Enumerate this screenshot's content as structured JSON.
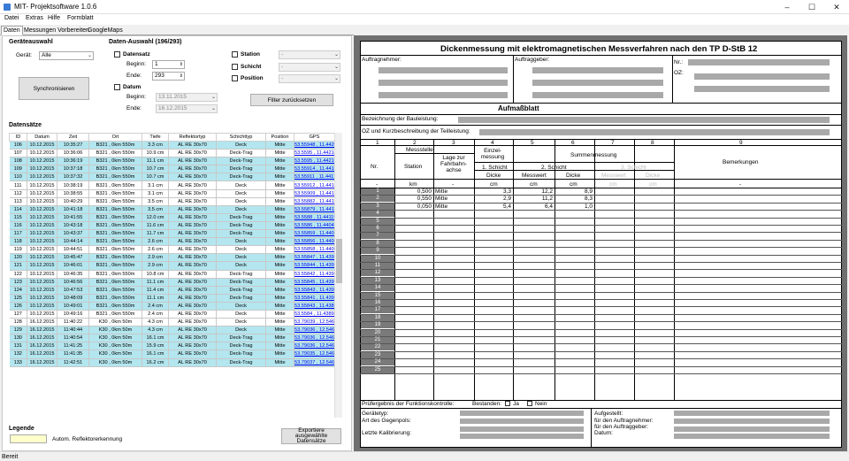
{
  "window": {
    "title": "MIT- Projektsoftware 1.0.6",
    "min": "–",
    "max": "☐",
    "close": "✕"
  },
  "menu": [
    "Datei",
    "Extras",
    "Hilfe",
    "Formblatt"
  ],
  "tabs": [
    "Daten",
    "Messungen Vorbereiten",
    "GoogleMaps"
  ],
  "geraet": {
    "group": "Geräteauswahl",
    "label": "Gerät:",
    "value": "Alle",
    "sync": "Synchronisieren"
  },
  "filter": {
    "group": "Daten-Auswahl (196/293)",
    "datensatz": "Datensatz",
    "beginn": "Beginn:",
    "ende": "Ende:",
    "beginn_val": "1",
    "ende_val": "293",
    "datum": "Datum",
    "datum_beginn": "13.11.2015",
    "datum_ende": "16.12.2015",
    "station": "Station",
    "schicht": "Schicht",
    "position": "Position",
    "dash": "-",
    "reset": "Filter zurücksetzen"
  },
  "datensaetze": {
    "title": "Datensätze",
    "headers": [
      "ID",
      "Datum",
      "Zeit",
      "Ort",
      "Tiefe",
      "Reflektortyp",
      "Schichttyp",
      "Position",
      "GPS"
    ],
    "rows": [
      [
        "106",
        "10.12.2015",
        "10:35:27",
        "B321 , 0km 550m",
        "3.3 cm",
        "AL RE 30x70",
        "Deck",
        "Mitte",
        "53.55948 , 11.44208",
        "cy"
      ],
      [
        "107",
        "10.12.2015",
        "10:36:06",
        "B321 , 0km 550m",
        "10.9 cm",
        "AL RE 30x70",
        "Deck-Trag",
        "Mitte",
        "53.5595 , 11.44214",
        "wh"
      ],
      [
        "108",
        "10.12.2015",
        "10:36:19",
        "B321 , 0km 550m",
        "11.1 cm",
        "AL RE 30x70",
        "Deck-Trag",
        "Mitte",
        "53.5595 , 11.44213",
        "cy"
      ],
      [
        "109",
        "10.12.2015",
        "10:37:18",
        "B321 , 0km 550m",
        "10.7 cm",
        "AL RE 30x70",
        "Deck-Trag",
        "Mitte",
        "53.55914 , 11.44169",
        "cy"
      ],
      [
        "110",
        "10.12.2015",
        "10:37:32",
        "B321 , 0km 550m",
        "10.7 cm",
        "AL RE 30x70",
        "Deck-Trag",
        "Mitte",
        "53.55911 , 11.44172",
        "cy"
      ],
      [
        "111",
        "10.12.2015",
        "10:38:19",
        "B321 , 0km 550m",
        "3.1 cm",
        "AL RE 30x70",
        "Deck",
        "Mitte",
        "53.55912 , 11.44166",
        "wh"
      ],
      [
        "112",
        "10.12.2015",
        "10:38:55",
        "B321 , 0km 550m",
        "3.1 cm",
        "AL RE 30x70",
        "Deck",
        "Mitte",
        "53.55909 , 11.44171",
        "wh"
      ],
      [
        "113",
        "10.12.2015",
        "10:40:29",
        "B321 , 0km 550m",
        "3.5 cm",
        "AL RE 30x70",
        "Deck",
        "Mitte",
        "53.55882 , 11.44112",
        "wh"
      ],
      [
        "114",
        "10.12.2015",
        "10:41:18",
        "B321 , 0km 550m",
        "3.5 cm",
        "AL RE 30x70",
        "Deck",
        "Mitte",
        "53.55879 , 11.44116",
        "cy"
      ],
      [
        "115",
        "10.12.2015",
        "10:41:55",
        "B321 , 0km 550m",
        "12.0 cm",
        "AL RE 30x70",
        "Deck-Trag",
        "Mitte",
        "53.5588 , 11.44119",
        "cy"
      ],
      [
        "116",
        "10.12.2015",
        "10:43:18",
        "B321 , 0km 550m",
        "11.6 cm",
        "AL RE 30x70",
        "Deck-Trag",
        "Mitte",
        "53.5586 , 11.44049",
        "cy"
      ],
      [
        "117",
        "10.12.2015",
        "10:43:37",
        "B321 , 0km 550m",
        "11.7 cm",
        "AL RE 30x70",
        "Deck-Trag",
        "Mitte",
        "53.55859 , 11.44051",
        "cy"
      ],
      [
        "118",
        "10.12.2015",
        "10:44:14",
        "B321 , 0km 550m",
        "2.6 cm",
        "AL RE 30x70",
        "Deck",
        "Mitte",
        "53.55856 , 11.44046",
        "cy"
      ],
      [
        "119",
        "10.12.2015",
        "10:44:51",
        "B321 , 0km 550m",
        "2.6 cm",
        "AL RE 30x70",
        "Deck",
        "Mitte",
        "53.55858 , 11.44046",
        "wh"
      ],
      [
        "120",
        "10.12.2015",
        "10:45:47",
        "B321 , 0km 550m",
        "2.9 cm",
        "AL RE 30x70",
        "Deck",
        "Mitte",
        "53.55847 , 11.43972",
        "cy"
      ],
      [
        "121",
        "10.12.2015",
        "10:46:01",
        "B321 , 0km 550m",
        "2.9 cm",
        "AL RE 30x70",
        "Deck",
        "Mitte",
        "53.55844 , 11.43972",
        "cy"
      ],
      [
        "122",
        "10.12.2015",
        "10:46:35",
        "B321 , 0km 550m",
        "10.8 cm",
        "AL RE 30x70",
        "Deck-Trag",
        "Mitte",
        "53.55842 , 11.43976",
        "wh"
      ],
      [
        "123",
        "10.12.2015",
        "10:46:56",
        "B321 , 0km 550m",
        "11.1 cm",
        "AL RE 30x70",
        "Deck-Trag",
        "Mitte",
        "53.55845 , 11.43977",
        "cy"
      ],
      [
        "124",
        "10.12.2015",
        "10:47:53",
        "B321 , 0km 550m",
        "11.4 cm",
        "AL RE 30x70",
        "Deck-Trag",
        "Mitte",
        "53.55843 , 11.439",
        "cy"
      ],
      [
        "125",
        "10.12.2015",
        "10:48:09",
        "B321 , 0km 550m",
        "11.1 cm",
        "AL RE 30x70",
        "Deck-Trag",
        "Mitte",
        "53.55841 , 11.439",
        "cy"
      ],
      [
        "126",
        "10.12.2015",
        "10:49:01",
        "B321 , 0km 550m",
        "2.4 cm",
        "AL RE 30x70",
        "Deck",
        "Mitte",
        "53.55843 , 11.43898",
        "cy"
      ],
      [
        "127",
        "10.12.2015",
        "10:49:16",
        "B321 , 0km 550m",
        "2.4 cm",
        "AL RE 30x70",
        "Deck",
        "Mitte",
        "53.5584 , 11.43898",
        "wh"
      ],
      [
        "128",
        "16.12.2015",
        "11:40:22",
        "K30 , 0km 50m",
        "4.3 cm",
        "AL RE 30x70",
        "Deck",
        "Mitte",
        "53.79039 , 12.54658",
        "wh"
      ],
      [
        "129",
        "16.12.2015",
        "11:40:44",
        "K30 , 0km 50m",
        "4.3 cm",
        "AL RE 30x70",
        "Deck",
        "Mitte",
        "53.79036 , 12.54654",
        "cy"
      ],
      [
        "130",
        "16.12.2015",
        "11:40:54",
        "K30 , 0km 50m",
        "16.1 cm",
        "AL RE 30x70",
        "Deck-Trag",
        "Mitte",
        "53.79036 , 12.54657",
        "cy"
      ],
      [
        "131",
        "16.12.2015",
        "11:41:25",
        "K30 , 0km 50m",
        "15.9 cm",
        "AL RE 30x70",
        "Deck-Trag",
        "Mitte",
        "53.79036 , 12.5466",
        "cy"
      ],
      [
        "132",
        "16.12.2015",
        "11:41:35",
        "K30 , 0km 50m",
        "16.1 cm",
        "AL RE 30x70",
        "Deck-Trag",
        "Mitte",
        "53.79035 , 12.5466",
        "cy"
      ],
      [
        "133",
        "16.12.2015",
        "11:42:51",
        "K30 , 0km 50m",
        "16.2 cm",
        "AL RE 30x70",
        "Deck-Trag",
        "Mitte",
        "53.79037 , 12.54662",
        "cy"
      ]
    ]
  },
  "legende": {
    "title": "Legende",
    "text": "Autom. Reflektorerkennung",
    "export": "Exportiere ausgewählte Datensätze"
  },
  "status": "Bereit",
  "form": {
    "title": "Dickenmessung mit elektromagnetischen Messverfahren nach den TP D-StB 12",
    "auftragnehmer": "Auftragnehmer:",
    "auftraggeber": "Auftraggeber:",
    "nr": "Nr.:",
    "oz": "OZ:",
    "aufmass": "Aufmaßblatt",
    "bezeichnung": "Bezeichnung der Bauleistung:",
    "oz_kurz": "OZ und Kurzbeschreibung der Teilleistung:",
    "colnums": [
      "1",
      "2",
      "3",
      "4",
      "5",
      "6",
      "7",
      "8",
      "9"
    ],
    "messstelle": "Messstelle",
    "nr_label": "Nr.",
    "station": "Station",
    "lage": "Lage zur Fahrbahn- achse",
    "einzel": "Einzel- messung",
    "summen": "Summenmessung",
    "schicht1": "1. Schicht",
    "schicht2": "2. Schicht",
    "schicht3": "3. Schicht",
    "dicke": "Dicke",
    "messwert": "Messwert",
    "bemerkungen": "Bemerkungen",
    "u_nr": "-",
    "u_station": "km",
    "u_lage": "-",
    "u_cm": "cm",
    "rows": [
      [
        "1",
        "0,500",
        "Mitte",
        "3,3",
        "12,2",
        "8,9"
      ],
      [
        "2",
        "0,550",
        "Mitte",
        "2,9",
        "11,2",
        "8,3"
      ],
      [
        "3",
        "0,050",
        "Mitte",
        "5,4",
        "6,4",
        "1,0"
      ]
    ],
    "fk": "Prüfergebnis der Funktionskontrolle:",
    "bestanden": "Bestanden:",
    "ja": "Ja",
    "nein": "Nein",
    "geraetetyp": "Gerätetyp:",
    "gegenpol": "Art des Gegenpols:",
    "kalibrierung": "Letzte Kalibrierung:",
    "aufgestellt": "Aufgestellt:",
    "fuer_an": "für den Auftragnehmer:",
    "fuer_ag": "für den Auftraggeber:",
    "datum": "Datum:"
  }
}
